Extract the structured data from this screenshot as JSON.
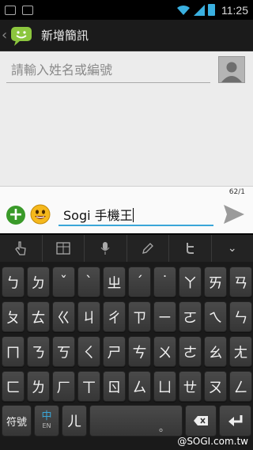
{
  "status_bar": {
    "time": "11:25"
  },
  "header": {
    "title": "新增簡訊"
  },
  "recipient": {
    "placeholder": "請輸入姓名或編號"
  },
  "compose": {
    "counter": "62/1",
    "message": "Sogi 手機王"
  },
  "keyboard": {
    "rows": [
      [
        "ㄅ",
        "ㄉ",
        "ˇ",
        "ˋ",
        "ㄓ",
        "ˊ",
        "˙",
        "ㄚ",
        "ㄞ",
        "ㄢ"
      ],
      [
        "ㄆ",
        "ㄊ",
        "ㄍ",
        "ㄐ",
        "ㄔ",
        "ㄗ",
        "ㄧ",
        "ㄛ",
        "ㄟ",
        "ㄣ"
      ],
      [
        "ㄇ",
        "ㄋ",
        "ㄎ",
        "ㄑ",
        "ㄕ",
        "ㄘ",
        "ㄨ",
        "ㄜ",
        "ㄠ",
        "ㄤ"
      ],
      [
        "ㄈ",
        "ㄌ",
        "ㄏ",
        "ㄒ",
        "ㄖ",
        "ㄙ",
        "ㄩ",
        "ㄝ",
        "ㄡ",
        "ㄥ"
      ]
    ],
    "symbols_label": "符號",
    "lang_label": "中",
    "lang_sub": "EN",
    "er_key": "ㄦ",
    "space_sub": "。"
  },
  "watermark": "@SOGI.com.tw",
  "colors": {
    "accent": "#3aa6d8",
    "add_green": "#3a9a2a",
    "keyboard_bg": "#1a1a1a"
  }
}
